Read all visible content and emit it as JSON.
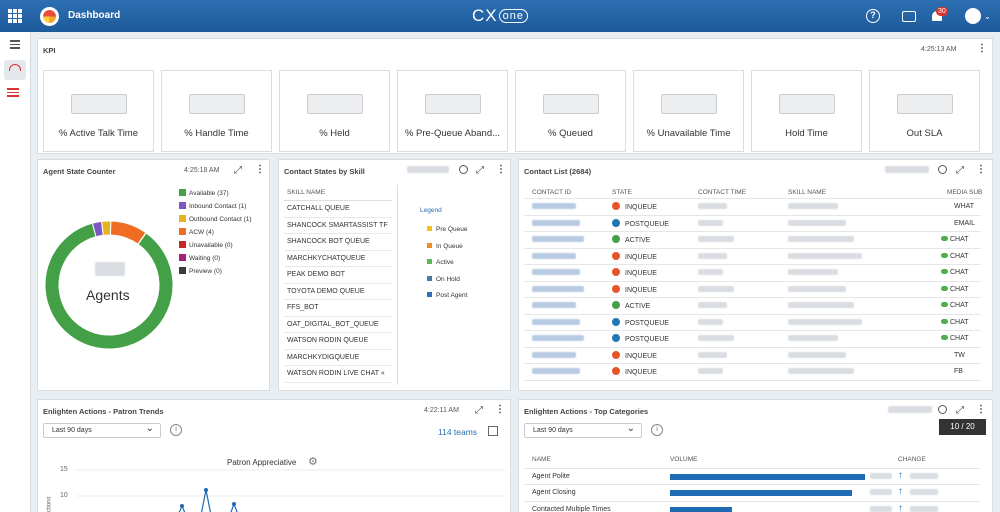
{
  "header": {
    "title": "Dashboard",
    "brand": "CX",
    "brand_suffix": "one",
    "help": "?",
    "notifications": "30"
  },
  "kpi": {
    "title": "KPI",
    "time": "4:25:13 AM",
    "cards": [
      {
        "label": "% Active Talk Time"
      },
      {
        "label": "% Handle Time"
      },
      {
        "label": "% Held"
      },
      {
        "label": "% Pre-Queue Aband..."
      },
      {
        "label": "% Queued"
      },
      {
        "label": "% Unavailable Time"
      },
      {
        "label": "Hold Time"
      },
      {
        "label": "Out SLA"
      }
    ]
  },
  "agent_state": {
    "title": "Agent State Counter",
    "time": "4:25:18 AM",
    "center_label": "Agents",
    "legend": [
      {
        "label": "Available (37)",
        "color": "#43a047"
      },
      {
        "label": "Inbound Contact (1)",
        "color": "#7e57c2"
      },
      {
        "label": "Outbound Contact (1)",
        "color": "#e6b422"
      },
      {
        "label": "ACW (4)",
        "color": "#ef6c22"
      },
      {
        "label": "Unavailable (0)",
        "color": "#c62828"
      },
      {
        "label": "Waiting (0)",
        "color": "#a5207a"
      },
      {
        "label": "Preview (0)",
        "color": "#3a3a3a"
      }
    ],
    "chart_data": {
      "type": "pie",
      "categories": [
        "Available",
        "Inbound Contact",
        "Outbound Contact",
        "ACW"
      ],
      "values": [
        37,
        1,
        1,
        4
      ]
    }
  },
  "skills": {
    "title": "Contact States by Skill",
    "column": "SKILL NAME",
    "rows": [
      "CATCHALL QUEUE",
      "SHANCOCK SMARTASSIST TF",
      "SHANCOCK BOT QUEUE",
      "MARCHKYCHATQUEUE",
      "PEAK DEMO BOT",
      "TOYOTA DEMO QUEUE",
      "FFS_BOT",
      "OAT_DIGITAL_BOT_QUEUE",
      "WATSON RODIN QUEUE",
      "MARCHKYDIGQUEUE",
      "WATSON RODIN LIVE CHAT «"
    ],
    "legend_title": "Legend",
    "legend": [
      {
        "label": "Pre Queue",
        "color": "#f0c419"
      },
      {
        "label": "In Queue",
        "color": "#f08a24"
      },
      {
        "label": "Active",
        "color": "#5cb85c"
      },
      {
        "label": "On Hold",
        "color": "#4a7aa8"
      },
      {
        "label": "Post Agent",
        "color": "#2c6fbf"
      }
    ]
  },
  "contacts": {
    "title": "Contact List (2684)",
    "columns": [
      "CONTACT ID",
      "STATE",
      "CONTACT TIME",
      "SKILL NAME",
      "MEDIA SUB"
    ],
    "rows": [
      {
        "state": "INQUEUE",
        "color": "#e8542a",
        "media": "WHAT",
        "chat": false
      },
      {
        "state": "POSTQUEUE",
        "color": "#1f78b4",
        "media": "EMAIL",
        "chat": false
      },
      {
        "state": "ACTIVE",
        "color": "#43a047",
        "media": "CHAT",
        "chat": true
      },
      {
        "state": "INQUEUE",
        "color": "#e8542a",
        "media": "CHAT",
        "chat": true
      },
      {
        "state": "INQUEUE",
        "color": "#e8542a",
        "media": "CHAT",
        "chat": true
      },
      {
        "state": "INQUEUE",
        "color": "#e8542a",
        "media": "CHAT",
        "chat": true
      },
      {
        "state": "ACTIVE",
        "color": "#43a047",
        "media": "CHAT",
        "chat": true
      },
      {
        "state": "POSTQUEUE",
        "color": "#1f78b4",
        "media": "CHAT",
        "chat": true
      },
      {
        "state": "POSTQUEUE",
        "color": "#1f78b4",
        "media": "CHAT",
        "chat": true
      },
      {
        "state": "INQUEUE",
        "color": "#e8542a",
        "media": "TW",
        "chat": false
      },
      {
        "state": "INQUEUE",
        "color": "#e8542a",
        "media": "FB",
        "chat": false
      }
    ]
  },
  "trends": {
    "title": "Enlighten Actions - Patron Trends",
    "time": "4:22:11 AM",
    "range": "Last 90 days",
    "teams": "114 teams",
    "chart_title": "Patron Appreciative",
    "ylabel": "actions",
    "chart_data": {
      "type": "line",
      "yticks": [
        15,
        10
      ]
    }
  },
  "categories": {
    "title": "Enlighten Actions - Top Categories",
    "range": "Last 90 days",
    "pager": "10 / 20",
    "columns": [
      "NAME",
      "VOLUME",
      "CHANGE"
    ],
    "rows": [
      {
        "name": "Agent Polite",
        "volume": 0.88
      },
      {
        "name": "Agent Closing",
        "volume": 0.82
      },
      {
        "name": "Contacted Multiple Times",
        "volume": 0.28
      }
    ]
  }
}
